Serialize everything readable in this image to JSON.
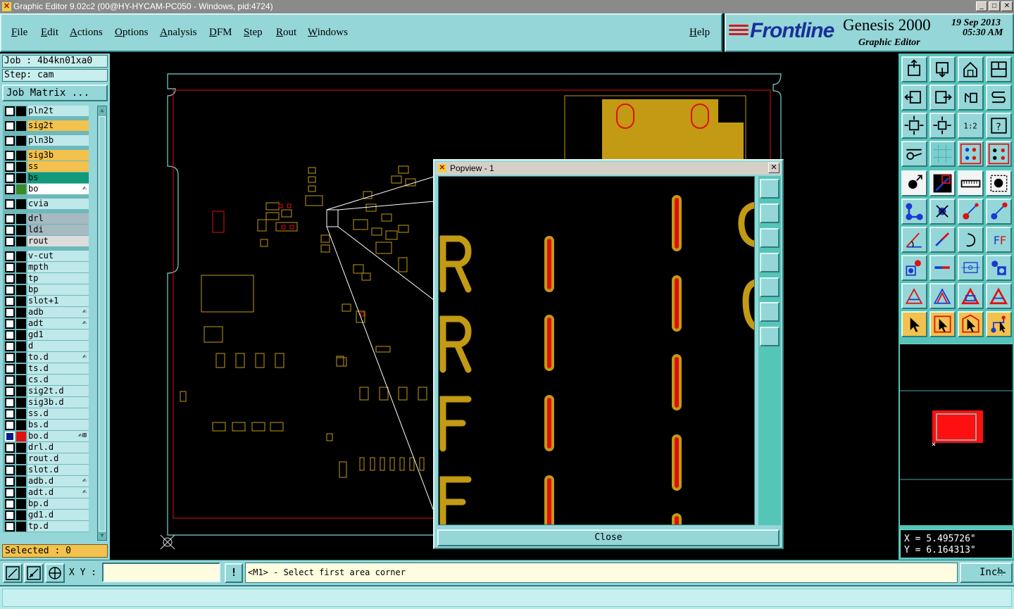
{
  "window": {
    "title": "Graphic Editor 9.02c2 (00@HY-HYCAM-PC050 - Windows, pid:4724)"
  },
  "menu": {
    "file": "File",
    "edit": "Edit",
    "actions": "Actions",
    "options": "Options",
    "analysis": "Analysis",
    "dfm": "DFM",
    "step": "Step",
    "rout": "Rout",
    "windows": "Windows",
    "help": "Help"
  },
  "brand": {
    "logo": "Frontline",
    "product": "Genesis 2000",
    "subtitle": "Graphic Editor",
    "date": "19 Sep 2013",
    "time": "05:30 AM"
  },
  "job": {
    "job_label": "Job : 4b4kn01xa0",
    "step_label": "Step: cam",
    "matrix_button": "Job Matrix ..."
  },
  "layers": [
    {
      "name": "pln2t",
      "color": "#000000",
      "bg": "#bfe8ea",
      "mark": ""
    },
    {
      "name": "sig2t",
      "color": "#000000",
      "bg": "#f3c14d",
      "mark": ""
    },
    {
      "name": "pln3b",
      "color": "#000000",
      "bg": "#bfe8ea",
      "mark": ""
    },
    {
      "name": "sig3b",
      "color": "#000000",
      "bg": "#f3c14d",
      "mark": ""
    },
    {
      "name": "ss",
      "color": "#000000",
      "bg": "#f3c14d",
      "mark": ""
    },
    {
      "name": "bs",
      "color": "#000000",
      "bg": "#119a7a",
      "mark": ""
    },
    {
      "name": "bo",
      "color": "#3a8a2a",
      "bg": "#ffffff",
      "mark": "✍"
    },
    {
      "name": "cvia",
      "color": "#000000",
      "bg": "#bfe8ea",
      "mark": ""
    },
    {
      "name": "drl",
      "color": "#000000",
      "bg": "#a7b9c1",
      "mark": ""
    },
    {
      "name": "ldi",
      "color": "#000000",
      "bg": "#a7b9c1",
      "mark": ""
    },
    {
      "name": "rout",
      "color": "#000000",
      "bg": "#dcdcdc",
      "mark": ""
    },
    {
      "name": "v-cut",
      "color": "#000000",
      "bg": "#bfe8ea",
      "mark": ""
    },
    {
      "name": "mpth",
      "color": "#000000",
      "bg": "#bfe8ea",
      "mark": ""
    },
    {
      "name": "tp",
      "color": "#000000",
      "bg": "#bfe8ea",
      "mark": ""
    },
    {
      "name": "bp",
      "color": "#000000",
      "bg": "#bfe8ea",
      "mark": ""
    },
    {
      "name": "slot+1",
      "color": "#000000",
      "bg": "#bfe8ea",
      "mark": ""
    },
    {
      "name": "adb",
      "color": "#000000",
      "bg": "#bfe8ea",
      "mark": "✍"
    },
    {
      "name": "adt",
      "color": "#000000",
      "bg": "#bfe8ea",
      "mark": "✍"
    },
    {
      "name": "gd1",
      "color": "#000000",
      "bg": "#bfe8ea",
      "mark": ""
    },
    {
      "name": "d",
      "color": "#000000",
      "bg": "#bfe8ea",
      "mark": ""
    },
    {
      "name": "to.d",
      "color": "#000000",
      "bg": "#bfe8ea",
      "mark": "✍"
    },
    {
      "name": "ts.d",
      "color": "#000000",
      "bg": "#bfe8ea",
      "mark": ""
    },
    {
      "name": "cs.d",
      "color": "#000000",
      "bg": "#bfe8ea",
      "mark": ""
    },
    {
      "name": "sig2t.d",
      "color": "#000000",
      "bg": "#bfe8ea",
      "mark": ""
    },
    {
      "name": "sig3b.d",
      "color": "#000000",
      "bg": "#bfe8ea",
      "mark": ""
    },
    {
      "name": "ss.d",
      "color": "#000000",
      "bg": "#bfe8ea",
      "mark": ""
    },
    {
      "name": "bs.d",
      "color": "#000000",
      "bg": "#bfe8ea",
      "mark": ""
    },
    {
      "name": "bo.d",
      "color": "#e01010",
      "bg": "#bfe8ea",
      "mark": "✍⊞",
      "active": true
    },
    {
      "name": "drl.d",
      "color": "#000000",
      "bg": "#bfe8ea",
      "mark": ""
    },
    {
      "name": "rout.d",
      "color": "#000000",
      "bg": "#bfe8ea",
      "mark": ""
    },
    {
      "name": "slot.d",
      "color": "#000000",
      "bg": "#bfe8ea",
      "mark": ""
    },
    {
      "name": "adb.d",
      "color": "#000000",
      "bg": "#bfe8ea",
      "mark": "✍"
    },
    {
      "name": "adt.d",
      "color": "#000000",
      "bg": "#bfe8ea",
      "mark": "✍"
    },
    {
      "name": "bp.d",
      "color": "#000000",
      "bg": "#bfe8ea",
      "mark": ""
    },
    {
      "name": "gd1.d",
      "color": "#000000",
      "bg": "#bfe8ea",
      "mark": ""
    },
    {
      "name": "tp.d",
      "color": "#000000",
      "bg": "#bfe8ea",
      "mark": ""
    }
  ],
  "selection": {
    "label": "Selected : 0"
  },
  "popview": {
    "title": "Popview - 1",
    "close_label": "Close"
  },
  "coords": {
    "x": "X = 5.495726\"",
    "y": "Y = 6.164313\""
  },
  "bottombar": {
    "xy_label": "X Y :",
    "xy_value": "",
    "prompt_button": "!",
    "status": "<M1> - Select first area corner",
    "unit": "Inch"
  },
  "colors": {
    "panel": "#95d6d8",
    "accent": "#f3c14d",
    "board_outline": "#e01010",
    "feature": "#c29a13"
  }
}
